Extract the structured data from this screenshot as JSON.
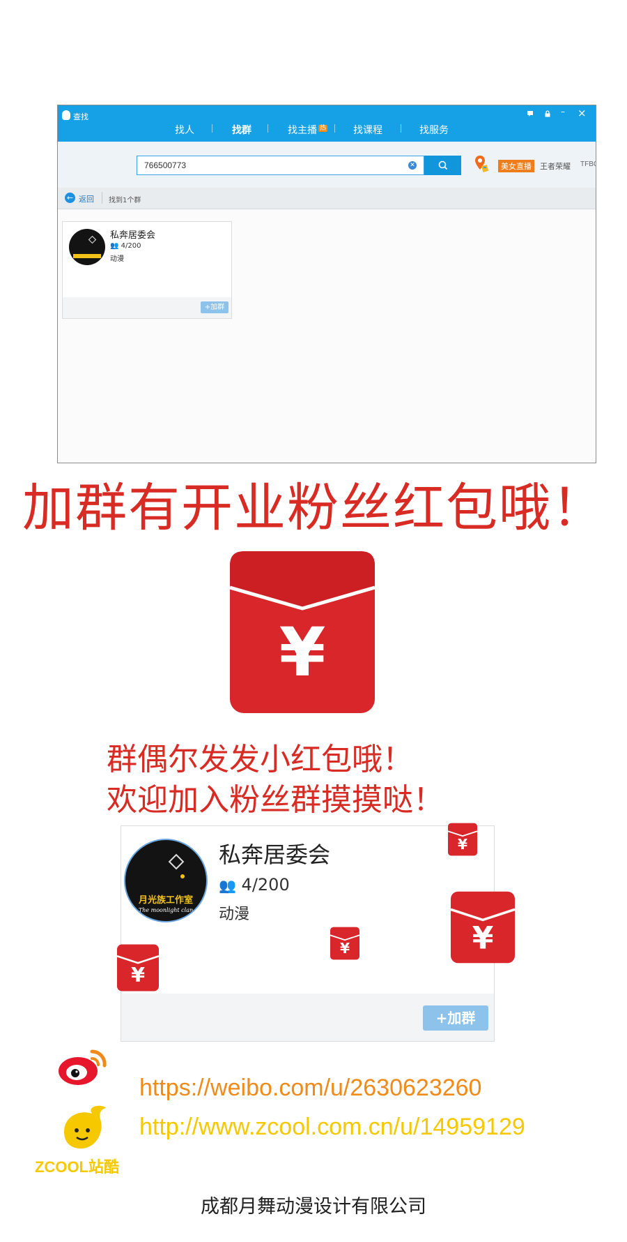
{
  "window": {
    "title": "查找",
    "tabs": [
      {
        "label": "找人"
      },
      {
        "label": "找群"
      },
      {
        "label": "找主播",
        "badge": "热"
      },
      {
        "label": "找课程"
      },
      {
        "label": "找服务"
      }
    ],
    "active_tab": "找群",
    "controls": [
      "feedback-icon",
      "lock-icon",
      "minimize-icon",
      "close-icon"
    ],
    "close_glyph": "×",
    "minimize_glyph": "–"
  },
  "search": {
    "value": "766500773",
    "tags": {
      "live": "美女直播",
      "game": "王者荣耀",
      "other": "TFBC"
    }
  },
  "nav": {
    "back_label": "返回",
    "result_count": "找到1个群"
  },
  "group": {
    "name": "私奔居委会",
    "members": "4/200",
    "category": "动漫",
    "join_label": "+加群",
    "avatar_text": "月光族工作室",
    "avatar_sub": "The moonlight clan"
  },
  "promo": {
    "headline": "加群有开业粉丝红包哦！",
    "line1": "群偶尔发发小红包哦！",
    "line2": "欢迎加入粉丝群摸摸哒！",
    "yen": "¥"
  },
  "footer": {
    "weibo_url": "https://weibo.com/u/2630623260",
    "zcool_url": "http://www.zcool.com.cn/u/14959129",
    "zcool_logo": "ZCOOL站酷",
    "company": "成都月舞动漫设计有限公司"
  },
  "colors": {
    "titlebar": "#16a0e6",
    "headline_red": "#d72b24",
    "envelope_red": "#d9262b",
    "weibo_orange": "#f08a18",
    "zcool_yellow": "#f5c800"
  }
}
